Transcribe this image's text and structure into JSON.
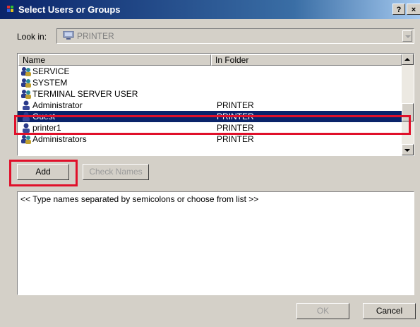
{
  "window": {
    "title": "Select Users or Groups",
    "help_button": "?",
    "close_button": "×"
  },
  "look_in": {
    "label": "Look in:",
    "value": "PRINTER"
  },
  "list": {
    "columns": [
      "Name",
      "In Folder"
    ],
    "rows": [
      {
        "name": "SERVICE",
        "folder": "",
        "icon": "group-icon",
        "selected": false
      },
      {
        "name": "SYSTEM",
        "folder": "",
        "icon": "group-icon",
        "selected": false
      },
      {
        "name": "TERMINAL SERVER USER",
        "folder": "",
        "icon": "group-icon",
        "selected": false
      },
      {
        "name": "Administrator",
        "folder": "PRINTER",
        "icon": "user-icon",
        "selected": false
      },
      {
        "name": "Guest",
        "folder": "PRINTER",
        "icon": "user-icon",
        "selected": true
      },
      {
        "name": "printer1",
        "folder": "PRINTER",
        "icon": "user-icon",
        "selected": false
      },
      {
        "name": "Administrators",
        "folder": "PRINTER",
        "icon": "group-icon",
        "selected": false
      }
    ]
  },
  "buttons": {
    "add": "Add",
    "check_names": "Check Names",
    "ok": "OK",
    "cancel": "Cancel"
  },
  "names_input": {
    "placeholder": "<< Type names separated by semicolons or choose from list >>"
  },
  "colors": {
    "selection": "#0a246a",
    "highlight": "#e0102a",
    "face": "#d4d0c8"
  }
}
